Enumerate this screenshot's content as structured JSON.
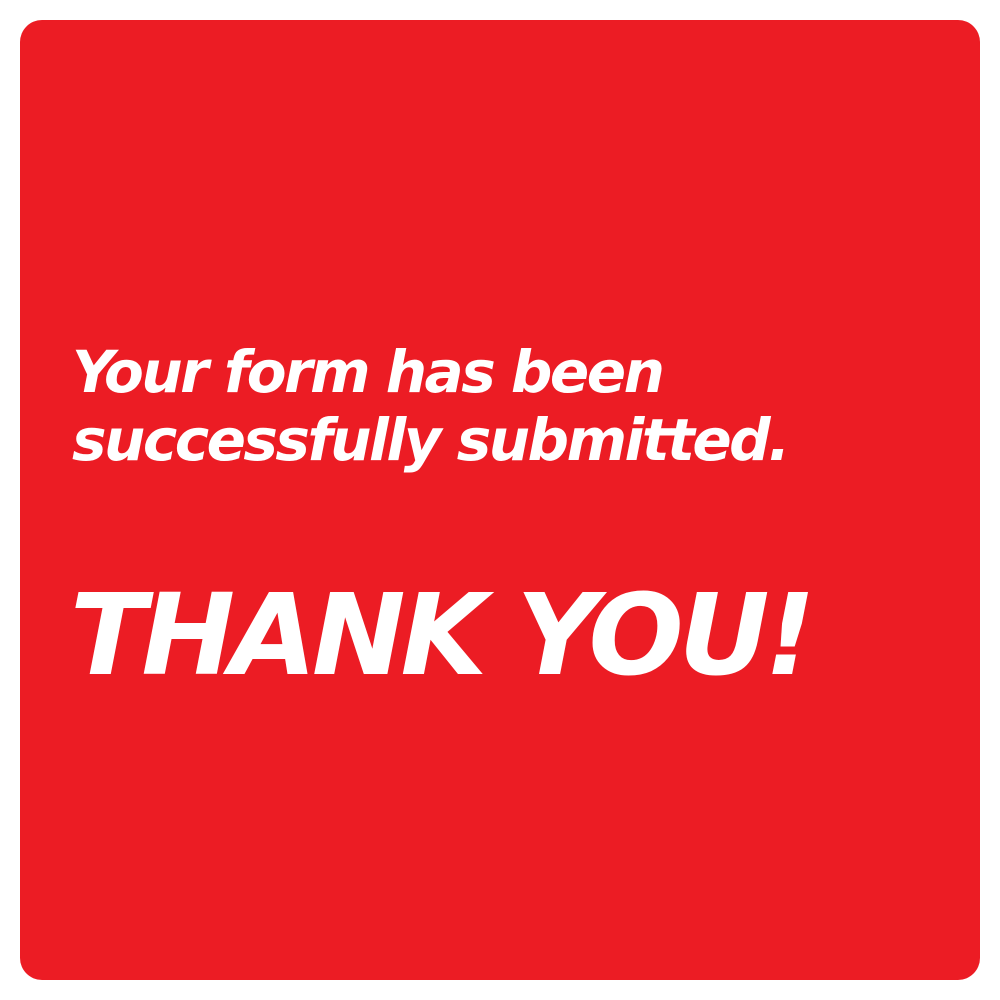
{
  "confirmation": {
    "message_line_1": "Your form has been",
    "message_line_2": "successfully submitted.",
    "thank_you": "THANK YOU!"
  },
  "colors": {
    "card_background": "#ec1c24",
    "text": "#ffffff",
    "page_background": "#ffffff"
  }
}
